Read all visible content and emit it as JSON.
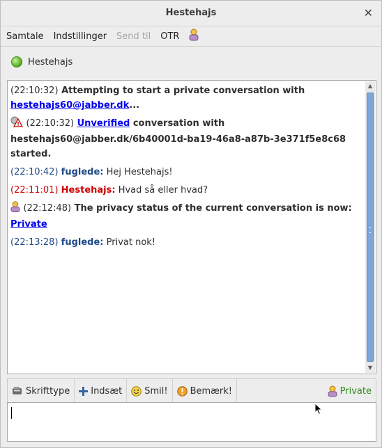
{
  "window": {
    "title": "Hestehajs",
    "close_glyph": "✕"
  },
  "menu": [
    {
      "label": "Samtale",
      "enabled": true
    },
    {
      "label": "Indstillinger",
      "enabled": true
    },
    {
      "label": "Send til",
      "enabled": false
    },
    {
      "label": "OTR",
      "enabled": true
    }
  ],
  "menu_icon": "otr-person-icon",
  "contact": {
    "name": "Hestehajs",
    "status_icon": "available-status-icon",
    "status_color": "#5fb32a"
  },
  "messages": [
    {
      "ts": "(22:10:32)",
      "text_before": "Attempting to start a private conversation with ",
      "link": "hestehajs60@jabber.dk",
      "text_after": "..."
    },
    {
      "ts": "(22:10:32)",
      "link": "Unverified",
      "text_after": " conversation with hestehajs60@jabber.dk/6b40001d-ba19-46a8-a87b-3e371f5e8c68 started."
    },
    {
      "ts": "(22:10:42)",
      "nick": "fuglede:",
      "text": "Hej Hestehajs!"
    },
    {
      "ts": "(22:11:01)",
      "nick": "Hestehajs:",
      "text": "Hvad så eller hvad?"
    },
    {
      "ts": "(22:12:48)",
      "text_before": "The privacy status of the current conversation is now: ",
      "link": "Private"
    },
    {
      "ts": "(22:13:28)",
      "nick": "fuglede:",
      "text": "Privat nok!"
    }
  ],
  "toolbar": {
    "font": "Skrifttype",
    "insert": "Indsæt",
    "smile": "Smil!",
    "attention": "Bemærk!",
    "privacy_status": "Private"
  },
  "colors": {
    "own_nick": "#204a87",
    "other_nick": "#cc0000",
    "private": "#2f8a1c",
    "link": "#0000ee"
  }
}
